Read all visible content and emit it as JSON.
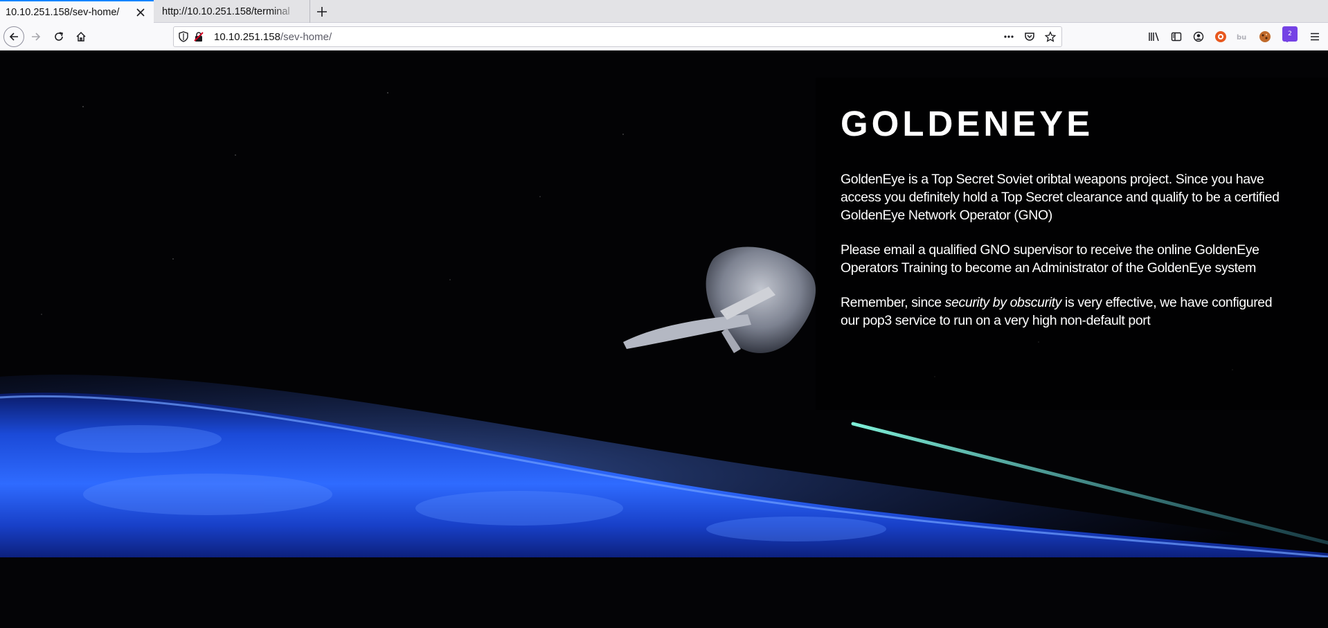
{
  "tabs": [
    {
      "title": "10.10.251.158/sev-home/",
      "active": true
    },
    {
      "title": "http://10.10.251.158/terminal",
      "active": false
    }
  ],
  "urlbar": {
    "host": "10.10.251.158",
    "path": "/sev-home/"
  },
  "toolbar": {
    "extension_badge": "2"
  },
  "page": {
    "title": "GOLDENEYE",
    "paragraph1": "GoldenEye is a Top Secret Soviet oribtal weapons project. Since you have access you definitely hold a Top Secret clearance and qualify to be a certified GoldenEye Network Operator (GNO)",
    "paragraph2": "Please email a qualified GNO supervisor to receive the online GoldenEye Operators Training to become an Administrator of the GoldenEye system",
    "paragraph3_before": "Remember, since ",
    "paragraph3_emphasis": "security by obscurity",
    "paragraph3_after": " is very effective, we have configured our pop3 service to run on a very high non-default port"
  },
  "icons": {
    "tab_close": "close-icon",
    "new_tab": "plus-icon",
    "back": "arrow-left-icon",
    "forward": "arrow-right-icon",
    "reload": "reload-icon",
    "home": "home-icon",
    "tracking": "shield-icon",
    "insecure": "insecure-lock-icon",
    "page_actions": "ellipsis-icon",
    "pocket": "pocket-icon",
    "bookmark": "star-icon",
    "library": "library-icon",
    "sidebar": "sidebar-icon",
    "account": "account-icon",
    "menu": "hamburger-menu-icon"
  },
  "colors": {
    "tab_accent": "#0a84ff",
    "page_background": "#030305",
    "earth_blue": "#1f5bff",
    "laser": "#5fd7c0",
    "text": "#ffffff"
  }
}
